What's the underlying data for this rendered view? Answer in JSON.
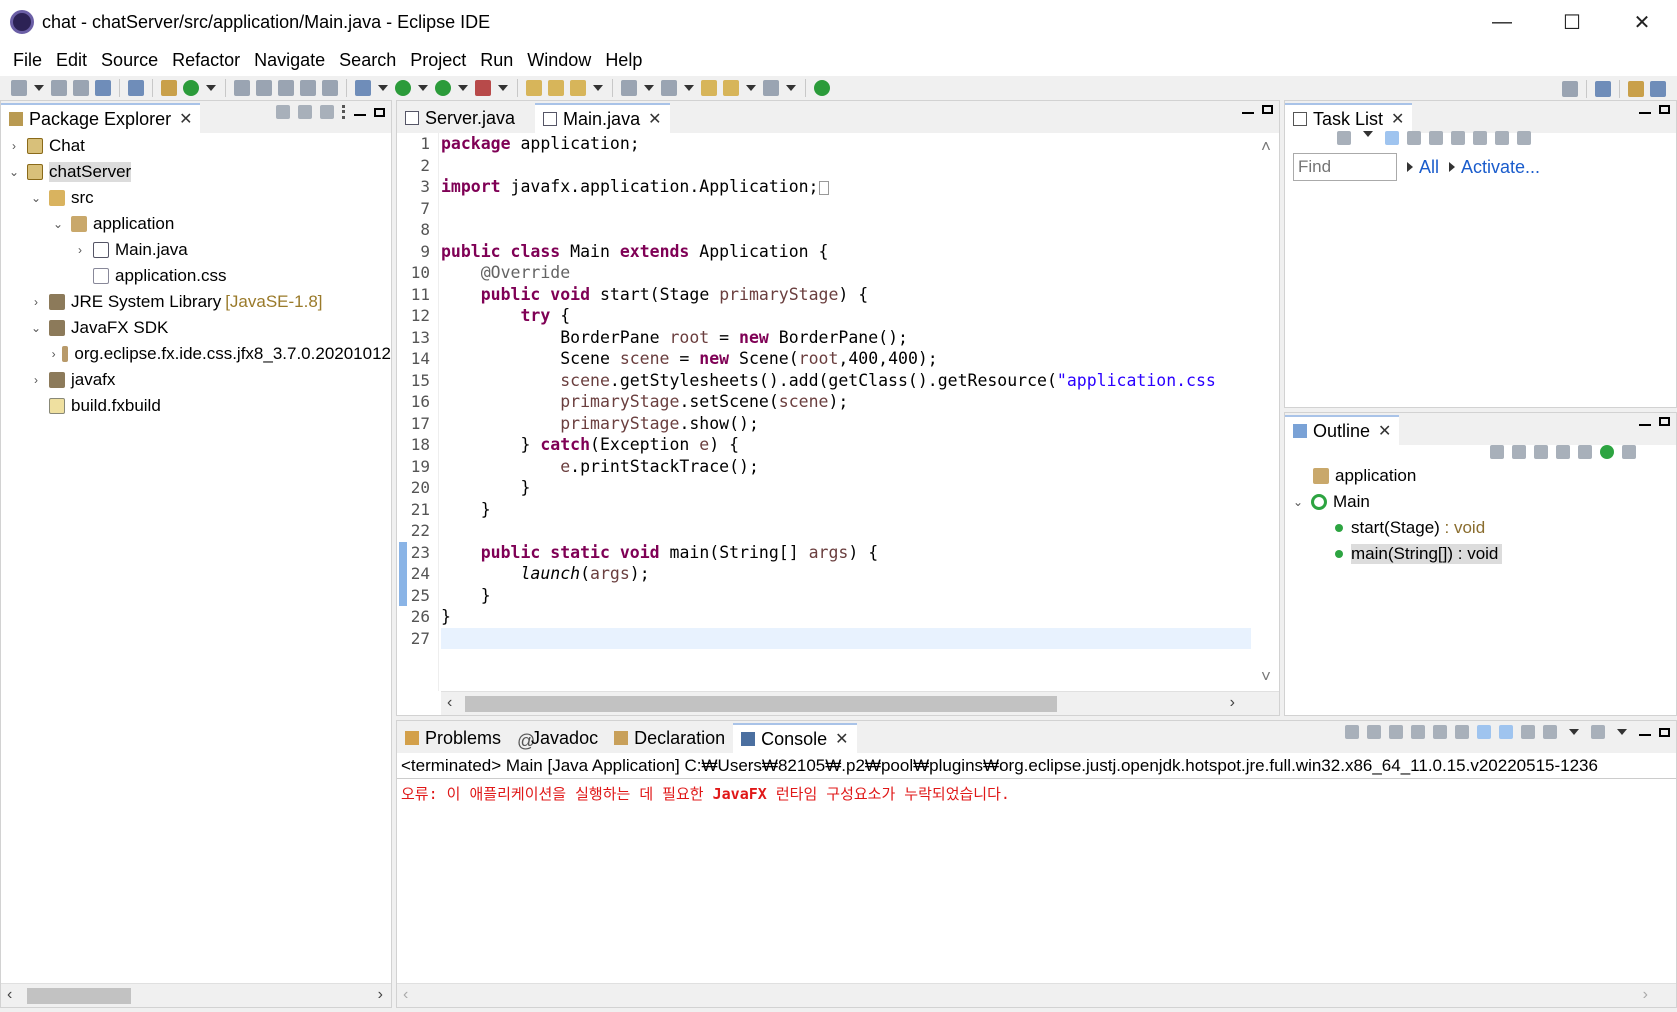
{
  "window": {
    "title": "chat - chatServer/src/application/Main.java - Eclipse IDE",
    "minimize": "—",
    "maximize": "☐",
    "close": "✕"
  },
  "menu": [
    "File",
    "Edit",
    "Source",
    "Refactor",
    "Navigate",
    "Search",
    "Project",
    "Run",
    "Window",
    "Help"
  ],
  "package_explorer": {
    "tab_label": "Package Explorer",
    "items": [
      {
        "label": "Chat",
        "decor": ""
      },
      {
        "label": "chatServer",
        "decor": ""
      },
      {
        "label": "src",
        "decor": ""
      },
      {
        "label": "application",
        "decor": ""
      },
      {
        "label": "Main.java",
        "decor": ""
      },
      {
        "label": "application.css",
        "decor": ""
      },
      {
        "label": "JRE System Library",
        "decor": "[JavaSE-1.8]"
      },
      {
        "label": "JavaFX SDK",
        "decor": ""
      },
      {
        "label": "org.eclipse.fx.ide.css.jfx8_3.7.0.20201012",
        "decor": ""
      },
      {
        "label": "javafx",
        "decor": ""
      },
      {
        "label": "build.fxbuild",
        "decor": ""
      }
    ]
  },
  "editor": {
    "tabs": [
      {
        "label": "Server.java"
      },
      {
        "label": "Main.java"
      }
    ],
    "line_numbers": [
      "1",
      "2",
      "3",
      "7",
      "8",
      "9",
      "10",
      "11",
      "12",
      "13",
      "14",
      "15",
      "16",
      "17",
      "18",
      "19",
      "20",
      "21",
      "22",
      "23",
      "24",
      "25",
      "26",
      "27"
    ],
    "code_lines": [
      "package application;",
      "",
      "import javafx.application.Application;",
      "",
      "",
      "public class Main extends Application {",
      "    @Override",
      "    public void start(Stage primaryStage) {",
      "        try {",
      "            BorderPane root = new BorderPane();",
      "            Scene scene = new Scene(root,400,400);",
      "            scene.getStylesheets().add(getClass().getResource(\"application.css",
      "            primaryStage.setScene(scene);",
      "            primaryStage.show();",
      "        } catch(Exception e) {",
      "            e.printStackTrace();",
      "        }",
      "    }",
      "",
      "    public static void main(String[] args) {",
      "        launch(args);",
      "    }",
      "}",
      ""
    ]
  },
  "task_list": {
    "tab_label": "Task List",
    "find_placeholder": "Find",
    "all_link": "All",
    "activate_link": "Activate..."
  },
  "outline": {
    "tab_label": "Outline",
    "package": "application",
    "class": "Main",
    "members": [
      {
        "name": "start(Stage)",
        "type": " : void"
      },
      {
        "name": "main(String[])",
        "type": " : void"
      }
    ]
  },
  "bottom": {
    "tabs": [
      "Problems",
      "Javadoc",
      "Declaration",
      "Console"
    ],
    "console_header": "<terminated> Main [Java Application] C:₩Users₩82105₩.p2₩pool₩plugins₩org.eclipse.justj.openjdk.hotspot.jre.full.win32.x86_64_11.0.15.v20220515-1236",
    "error_prefix": "오류: 이 애플리케이션을 실행하는 데 필요한 ",
    "error_bold": "JavaFX",
    "error_suffix": " 런타임 구성요소가 누락되었습니다."
  },
  "colors": {
    "keyword": "#7f0055",
    "string": "#2a00ff",
    "error": "#e01818",
    "current_line": "#e8f2fe",
    "link": "#1a5ccc"
  }
}
